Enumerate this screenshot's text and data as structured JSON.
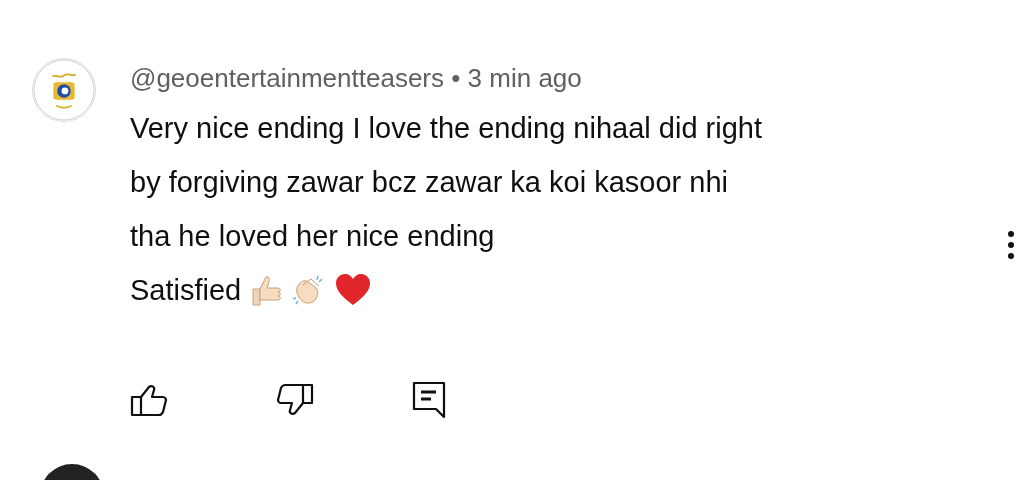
{
  "comment": {
    "author": "@geoentertainmentteasers",
    "separator": "•",
    "time": "3 min ago",
    "text": "Very nice ending I love the ending nihaal did right\nby forgiving zawar bcz zawar ka koi kasoor nhi\ntha he loved her nice ending",
    "last_line": "Satisfied"
  }
}
